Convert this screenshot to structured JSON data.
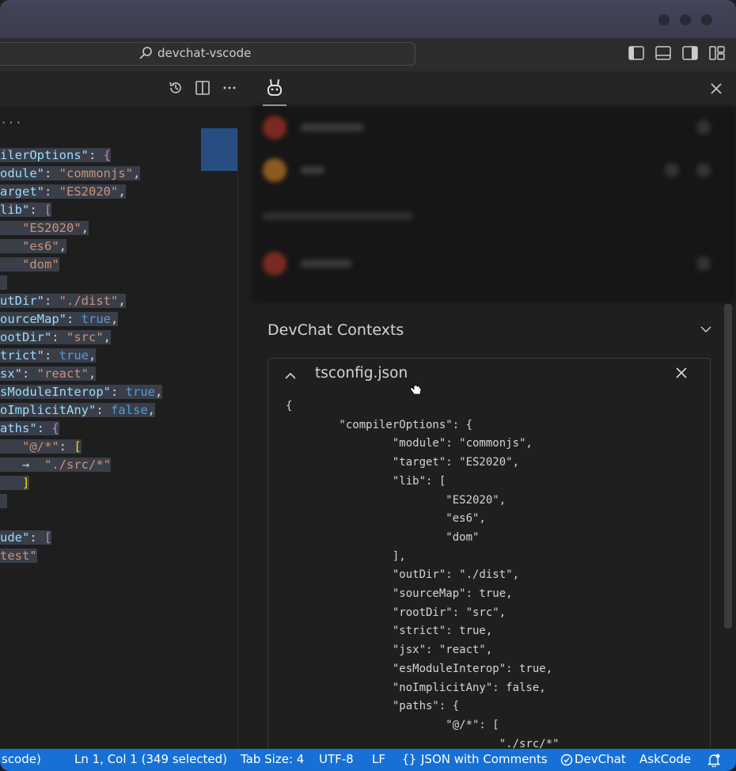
{
  "window": {
    "search_text": "devchat-vscode"
  },
  "editor": {
    "truncated_top": "..."
  },
  "panel": {
    "contexts_title": "DevChat Contexts",
    "context_file": "tsconfig.json"
  },
  "editor_lines": [
    {
      "parts": [
        [
          "k",
          "ilerOptions\""
        ],
        [
          "p",
          ": "
        ],
        [
          "br1",
          "{"
        ]
      ]
    },
    {
      "parts": [
        [
          "k",
          "odule\""
        ],
        [
          "p",
          ": "
        ],
        [
          "s",
          "\"commonjs\""
        ],
        [
          "p",
          ","
        ]
      ]
    },
    {
      "parts": [
        [
          "k",
          "arget\""
        ],
        [
          "p",
          ": "
        ],
        [
          "s",
          "\"ES2020\""
        ],
        [
          "p",
          ","
        ]
      ]
    },
    {
      "parts": [
        [
          "k",
          "lib\""
        ],
        [
          "p",
          ": "
        ],
        [
          "br1",
          "["
        ]
      ]
    },
    {
      "parts": [
        [
          "p",
          "   "
        ],
        [
          "s",
          "\"ES2020\""
        ],
        [
          "p",
          ","
        ]
      ]
    },
    {
      "parts": [
        [
          "p",
          "   "
        ],
        [
          "s",
          "\"es6\""
        ],
        [
          "p",
          ","
        ]
      ]
    },
    {
      "parts": [
        [
          "p",
          "   "
        ],
        [
          "s",
          "\"dom\""
        ]
      ]
    },
    {
      "parts": [
        [
          "p",
          " "
        ]
      ]
    },
    {
      "parts": [
        [
          "k",
          "utDir\""
        ],
        [
          "p",
          ": "
        ],
        [
          "s",
          "\"./dist\""
        ],
        [
          "p",
          ","
        ]
      ]
    },
    {
      "parts": [
        [
          "k",
          "ourceMap\""
        ],
        [
          "p",
          ": "
        ],
        [
          "b",
          "true"
        ],
        [
          "p",
          ","
        ]
      ]
    },
    {
      "parts": [
        [
          "k",
          "ootDir\""
        ],
        [
          "p",
          ": "
        ],
        [
          "s",
          "\"src\""
        ],
        [
          "p",
          ","
        ]
      ]
    },
    {
      "parts": [
        [
          "k",
          "trict\""
        ],
        [
          "p",
          ": "
        ],
        [
          "b",
          "true"
        ],
        [
          "p",
          ","
        ]
      ]
    },
    {
      "parts": [
        [
          "k",
          "sx\""
        ],
        [
          "p",
          ": "
        ],
        [
          "s",
          "\"react\""
        ],
        [
          "p",
          ","
        ]
      ]
    },
    {
      "parts": [
        [
          "k",
          "sModuleInterop\""
        ],
        [
          "p",
          ": "
        ],
        [
          "b",
          "true"
        ],
        [
          "p",
          ","
        ]
      ]
    },
    {
      "parts": [
        [
          "k",
          "oImplicitAny\""
        ],
        [
          "p",
          ": "
        ],
        [
          "b",
          "false"
        ],
        [
          "p",
          ","
        ]
      ]
    },
    {
      "parts": [
        [
          "k",
          "aths\""
        ],
        [
          "p",
          ": "
        ],
        [
          "br1",
          "{"
        ]
      ]
    },
    {
      "parts": [
        [
          "p",
          "   "
        ],
        [
          "s",
          "\"@/*\""
        ],
        [
          "p",
          ": "
        ],
        [
          "br2",
          "["
        ]
      ]
    },
    {
      "parts": [
        [
          "p",
          "   →  "
        ],
        [
          "s",
          "\"./src/*\""
        ]
      ]
    },
    {
      "parts": [
        [
          "p",
          "   "
        ],
        [
          "br2",
          "]"
        ]
      ]
    },
    {
      "parts": [
        [
          "p",
          " "
        ]
      ]
    },
    {
      "parts": []
    },
    {
      "parts": [
        [
          "k",
          "ude\""
        ],
        [
          "p",
          ": "
        ],
        [
          "br1",
          "["
        ]
      ]
    },
    {
      "parts": [
        [
          "s",
          "test\""
        ]
      ]
    }
  ],
  "context_lines": [
    "{",
    "        \"compilerOptions\": {",
    "                \"module\": \"commonjs\",",
    "                \"target\": \"ES2020\",",
    "                \"lib\": [",
    "                        \"ES2020\",",
    "                        \"es6\",",
    "                        \"dom\"",
    "                ],",
    "                \"outDir\": \"./dist\",",
    "                \"sourceMap\": true,",
    "                \"rootDir\": \"src\",",
    "                \"strict\": true,",
    "                \"jsx\": \"react\",",
    "                \"esModuleInterop\": true,",
    "                \"noImplicitAny\": false,",
    "                \"paths\": {",
    "                        \"@/*\": [",
    "                                \"./src/*\""
  ],
  "statusbar": {
    "left_partial": "scode)",
    "cursor_pos": "Ln 1, Col 1 (349 selected)",
    "tab_size": "Tab Size: 4",
    "encoding": "UTF-8",
    "eol": "LF",
    "language": "JSON with Comments",
    "devchat": "DevChat",
    "askcode": "AskCode"
  }
}
